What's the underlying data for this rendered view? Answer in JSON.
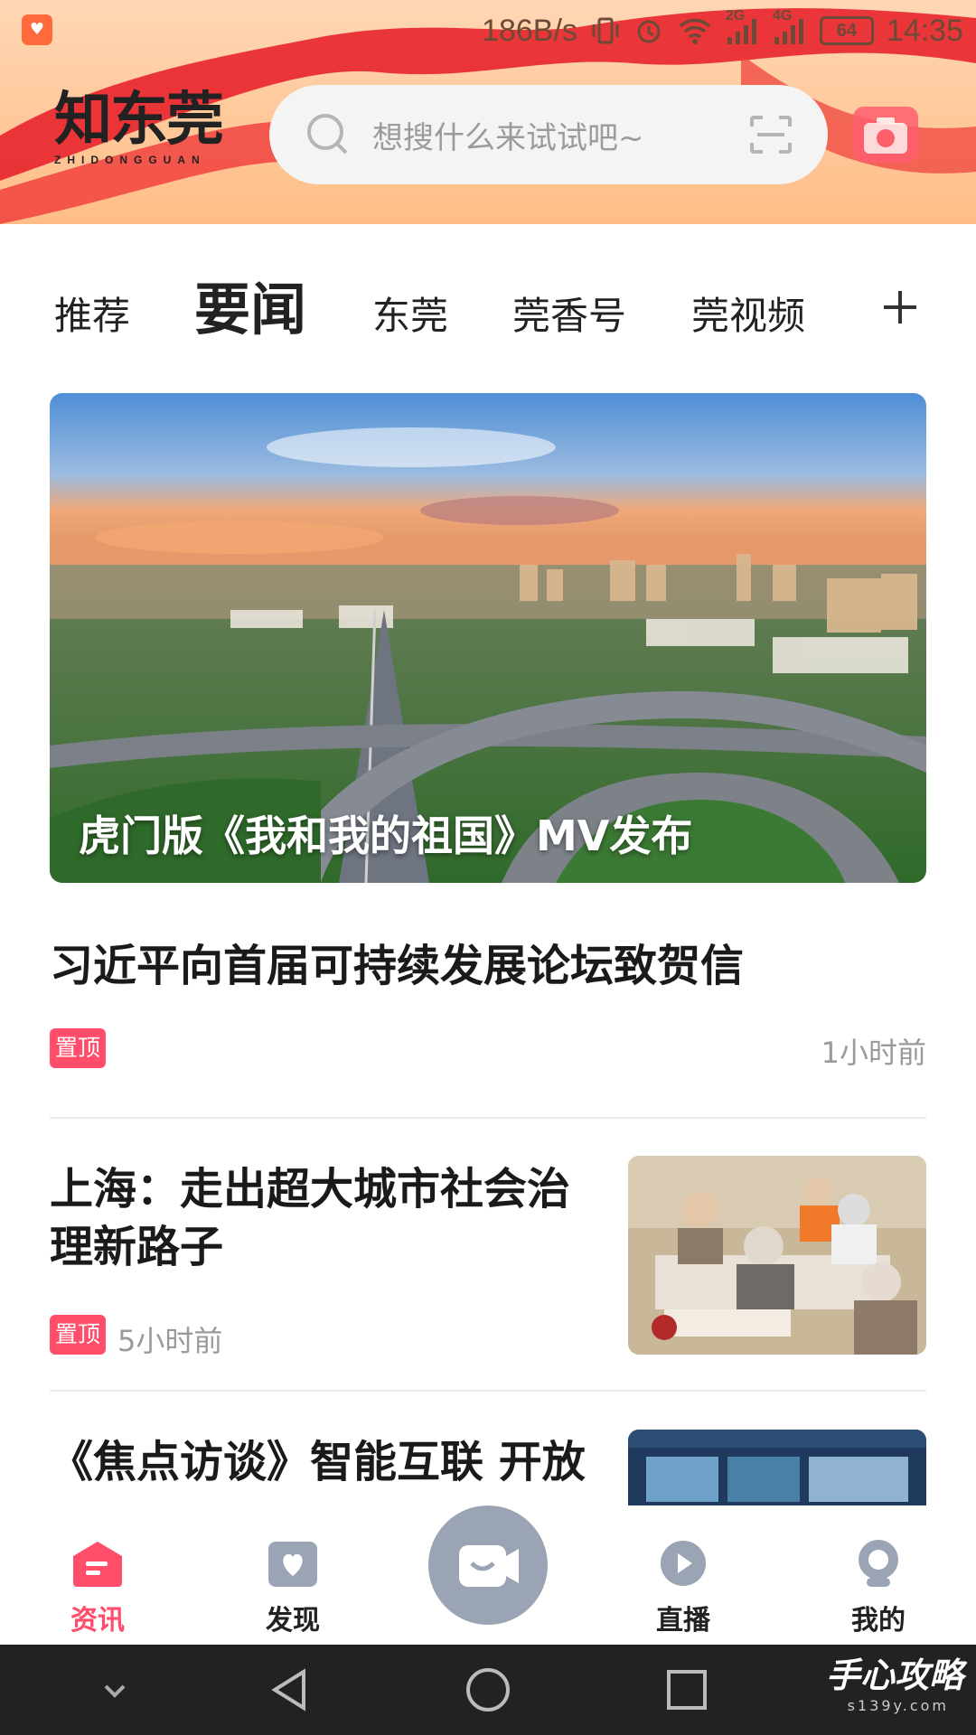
{
  "status_bar": {
    "speed": "186B/s",
    "net2": "2G",
    "net4": "4G",
    "battery": "64",
    "time": "14:35"
  },
  "header": {
    "logo_cn": "知东莞",
    "logo_en": "ZHIDONGGUAN",
    "search_placeholder": "想搜什么来试试吧~"
  },
  "tabs": [
    {
      "label": "推荐",
      "active": false
    },
    {
      "label": "要闻",
      "active": true
    },
    {
      "label": "东莞",
      "active": false
    },
    {
      "label": "莞香号",
      "active": false
    },
    {
      "label": "莞视频",
      "active": false
    }
  ],
  "hero": {
    "caption": "虎门版《我和我的祖国》MV发布"
  },
  "news": [
    {
      "title": "习近平向首届可持续发展论坛致贺信",
      "badge": "置顶",
      "time": "1小时前"
    },
    {
      "title_line1": "上海：走出超大城市社会治",
      "title_line2": "理新路子",
      "badge": "置顶",
      "time": "5小时前"
    },
    {
      "title": "《焦点访谈》智能互联 开放"
    }
  ],
  "bottom_nav": [
    {
      "label": "资讯",
      "active": true
    },
    {
      "label": "发现",
      "active": false
    },
    {
      "label": "直播",
      "active": false
    },
    {
      "label": "我的",
      "active": false
    }
  ],
  "watermark": {
    "text": "手心攻略",
    "sub": "s139y.com"
  },
  "colors": {
    "accent": "#ff4d6a",
    "header_bg": "#ffc89a",
    "ribbon": "#e8242c"
  }
}
